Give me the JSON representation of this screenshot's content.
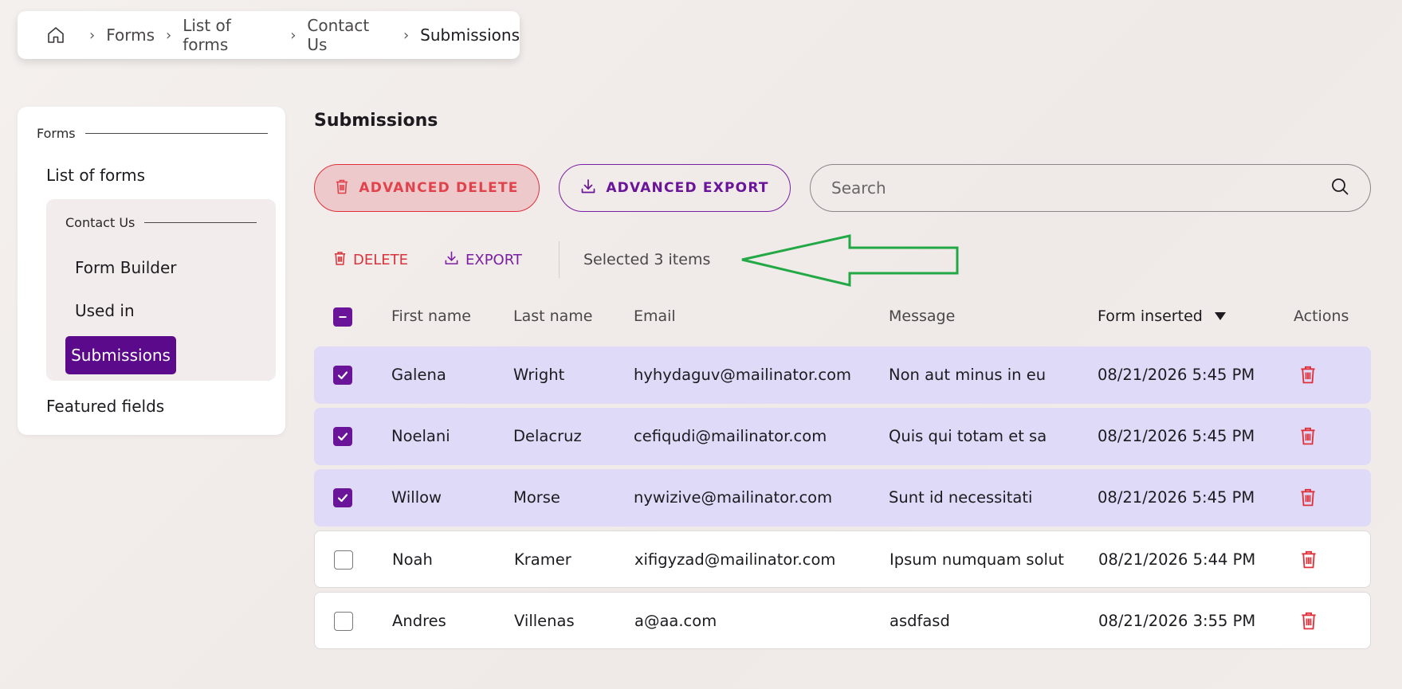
{
  "breadcrumb": {
    "home_icon": "home-icon",
    "items": [
      "Forms",
      "List of forms",
      "Contact Us",
      "Submissions"
    ]
  },
  "sidebar": {
    "section_label": "Forms",
    "list_of_forms": "List of forms",
    "sub_section_label": "Contact Us",
    "sub_items": [
      "Form Builder",
      "Used in",
      "Submissions"
    ],
    "featured_fields": "Featured fields"
  },
  "main": {
    "title": "Submissions",
    "advanced_delete": "ADVANCED DELETE",
    "advanced_export": "ADVANCED EXPORT",
    "search_placeholder": "Search",
    "bulk_delete": "DELETE",
    "bulk_export": "EXPORT",
    "selected_text": "Selected 3 items"
  },
  "table": {
    "columns": [
      "First name",
      "Last name",
      "Email",
      "Message",
      "Form inserted",
      "Actions"
    ],
    "sort_column": "Form inserted",
    "sort_direction": "desc",
    "rows": [
      {
        "first": "Galena",
        "last": "Wright",
        "email": "hyhydaguv@mailinator.com",
        "message": "Non aut minus in eu",
        "inserted": "08/21/2026 5:45 PM",
        "selected": true
      },
      {
        "first": "Noelani",
        "last": "Delacruz",
        "email": "cefiqudi@mailinator.com",
        "message": "Quis qui totam et sa",
        "inserted": "08/21/2026 5:45 PM",
        "selected": true
      },
      {
        "first": "Willow",
        "last": "Morse",
        "email": "nywizive@mailinator.com",
        "message": "Sunt id necessitati",
        "inserted": "08/21/2026 5:45 PM",
        "selected": true
      },
      {
        "first": "Noah",
        "last": "Kramer",
        "email": "xifigyzad@mailinator.com",
        "message": "Ipsum numquam solut",
        "inserted": "08/21/2026 5:44 PM",
        "selected": false
      },
      {
        "first": "Andres",
        "last": "Villenas",
        "email": "a@aa.com",
        "message": "asdfasd",
        "inserted": "08/21/2026 3:55 PM",
        "selected": false
      }
    ]
  },
  "colors": {
    "accent_purple": "#5c0a8c",
    "danger_red": "#e0313a",
    "selected_row": "#dedaf8",
    "annotation_arrow": "#22a845"
  }
}
